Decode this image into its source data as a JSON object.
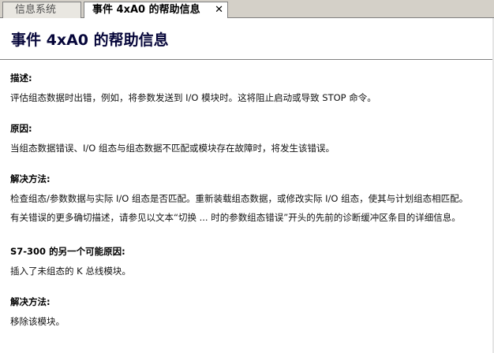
{
  "tabs": [
    {
      "label": "信息系统",
      "active": false
    },
    {
      "label": "事件 4xA0 的帮助信息",
      "active": true
    }
  ],
  "close_glyph": "✕",
  "page": {
    "title": "事件 4xA0 的帮助信息"
  },
  "sections": {
    "description": {
      "heading": "描述:",
      "text": "评估组态数据时出错，例如，将参数发送到 I/O 模块时。这将阻止启动或导致 STOP 命令。"
    },
    "cause": {
      "heading": "原因:",
      "text": "当组态数据错误、I/O 组态与组态数据不匹配或模块存在故障时，将发生该错误。"
    },
    "solution": {
      "heading": "解决方法:",
      "line1": "检查组态/参数数据与实际 I/O 组态是否匹配。重新装载组态数据，或修改实际 I/O 组态，使其与计划组态相匹配。",
      "line2": "有关错误的更多确切描述，请参见以文本“切换 ... 时的参数组态错误”开头的先前的诊断缓冲区条目的详细信息。"
    },
    "s7cause": {
      "heading": "S7-300 的另一个可能原因:",
      "text": "插入了未组态的 K 总线模块。"
    },
    "solution2": {
      "heading": "解决方法:",
      "text": "移除该模块。"
    }
  },
  "colors": {
    "title": "#06063a",
    "tabbar": "#d4d0c8"
  }
}
